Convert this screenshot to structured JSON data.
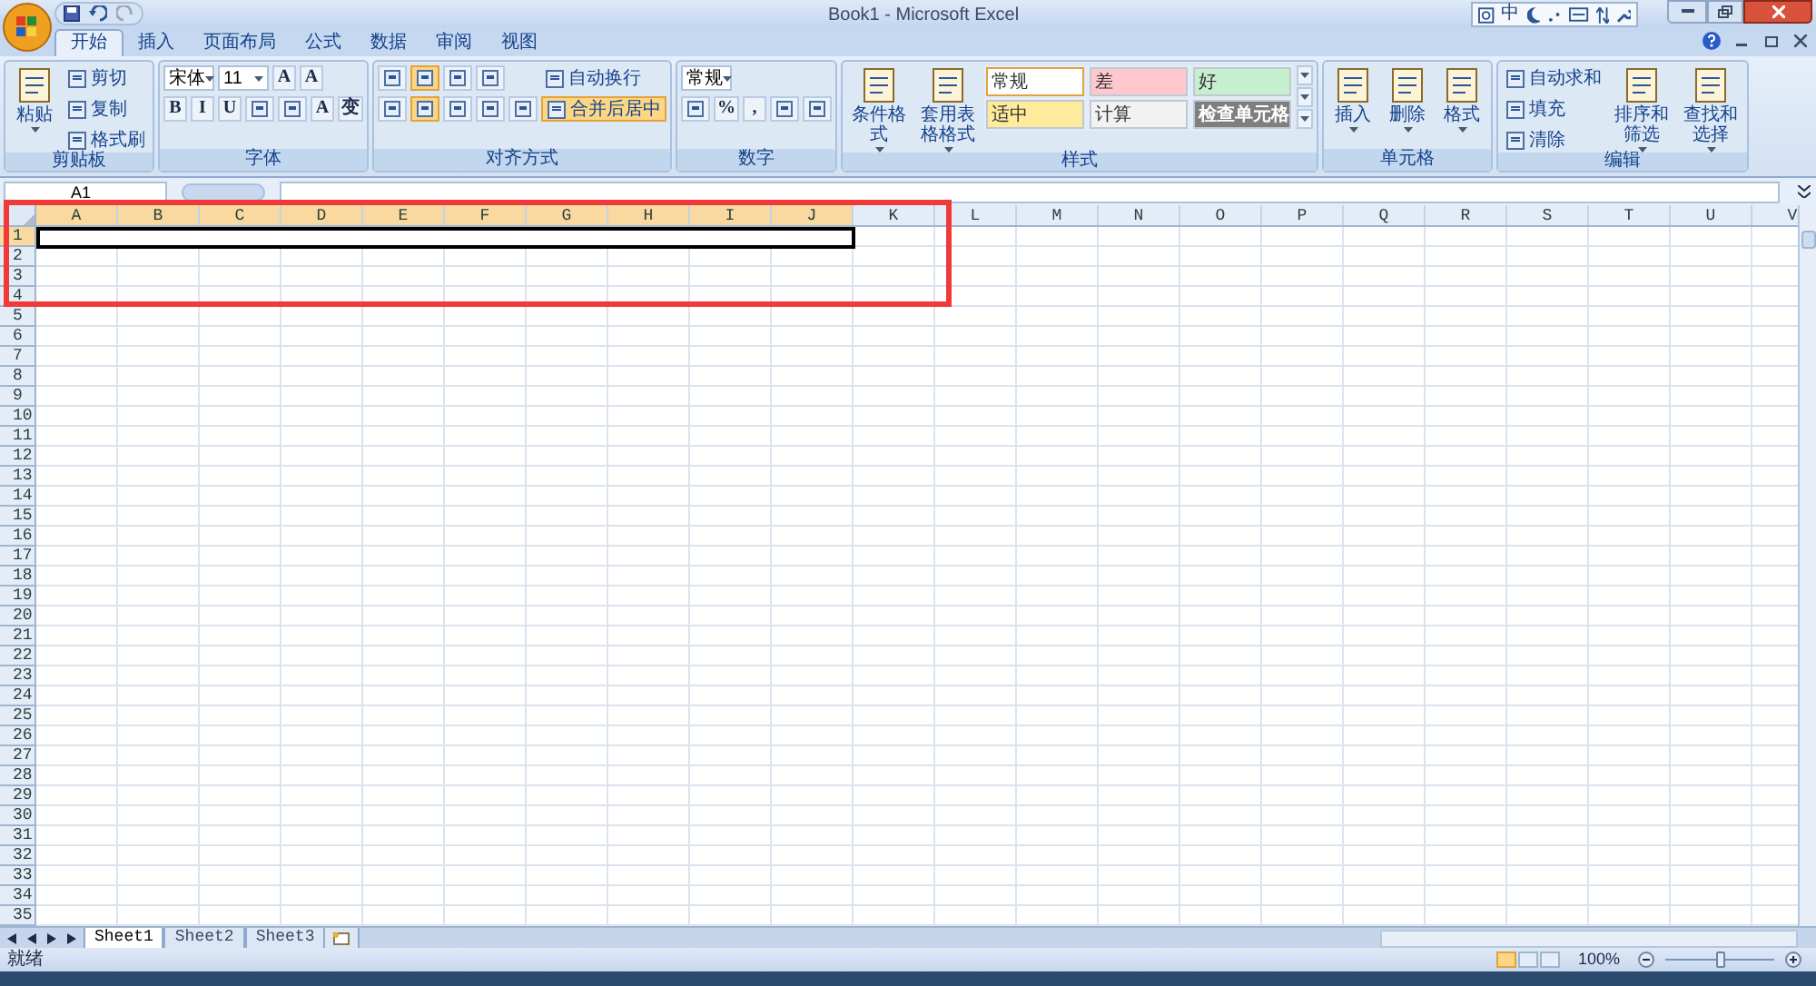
{
  "title_bar": {
    "title": "Book1 - Microsoft Excel",
    "ime_label": "中"
  },
  "tabs": [
    {
      "label": "开始",
      "selected": true
    },
    {
      "label": "插入",
      "selected": false
    },
    {
      "label": "页面布局",
      "selected": false
    },
    {
      "label": "公式",
      "selected": false
    },
    {
      "label": "数据",
      "selected": false
    },
    {
      "label": "审阅",
      "selected": false
    },
    {
      "label": "视图",
      "selected": false
    }
  ],
  "ribbon": {
    "groups": [
      {
        "label": "剪贴板",
        "items": [
          {
            "kind": "large",
            "label": "粘贴"
          },
          {
            "kind": "stack",
            "items": [
              {
                "kind": "small",
                "label": "剪切"
              },
              {
                "kind": "small",
                "label": "复制"
              },
              {
                "kind": "small",
                "label": "格式刷"
              }
            ]
          }
        ]
      },
      {
        "label": "字体",
        "items": [
          {
            "kind": "stack",
            "items": [
              {
                "kind": "row",
                "items": [
                  {
                    "kind": "combo",
                    "label": "宋体"
                  },
                  {
                    "kind": "combo",
                    "label": "11"
                  },
                  {
                    "kind": "text",
                    "label": "A"
                  },
                  {
                    "kind": "text",
                    "label": "A"
                  }
                ]
              },
              {
                "kind": "row",
                "items": [
                  {
                    "kind": "text",
                    "label": "B"
                  },
                  {
                    "kind": "text",
                    "label": "I"
                  },
                  {
                    "kind": "text",
                    "label": "U"
                  },
                  {
                    "kind": "icon"
                  },
                  {
                    "kind": "icon"
                  },
                  {
                    "kind": "text",
                    "label": "A"
                  },
                  {
                    "kind": "text",
                    "label": "变"
                  }
                ]
              }
            ]
          }
        ]
      },
      {
        "label": "对齐方式",
        "items": [
          {
            "kind": "stack",
            "items": [
              {
                "kind": "row",
                "items": [
                  {
                    "kind": "icon",
                    "on": false
                  },
                  {
                    "kind": "icon",
                    "on": true
                  },
                  {
                    "kind": "icon",
                    "on": false
                  },
                  {
                    "kind": "icon",
                    "on": false
                  }
                ]
              },
              {
                "kind": "row",
                "items": [
                  {
                    "kind": "icon",
                    "on": false
                  },
                  {
                    "kind": "icon",
                    "on": true
                  },
                  {
                    "kind": "icon",
                    "on": false
                  },
                  {
                    "kind": "icon",
                    "on": false
                  },
                  {
                    "kind": "icon",
                    "on": false
                  }
                ]
              }
            ]
          },
          {
            "kind": "stack",
            "items": [
              {
                "kind": "small",
                "label": "自动换行",
                "on": false
              },
              {
                "kind": "small",
                "label": "合并后居中",
                "on": true
              }
            ]
          }
        ]
      },
      {
        "label": "数字",
        "items": [
          {
            "kind": "stack",
            "items": [
              {
                "kind": "combo",
                "label": "常规"
              },
              {
                "kind": "row",
                "items": [
                  {
                    "kind": "icon"
                  },
                  {
                    "kind": "text",
                    "label": "%"
                  },
                  {
                    "kind": "text",
                    "label": ","
                  },
                  {
                    "kind": "icon"
                  },
                  {
                    "kind": "icon"
                  }
                ]
              }
            ]
          }
        ]
      },
      {
        "label": "样式",
        "items": [
          {
            "kind": "large",
            "label": "条件格式"
          },
          {
            "kind": "large",
            "label": "套用表格格式"
          },
          {
            "kind": "styles",
            "items": [
              {
                "label": "常规",
                "color": "#ffffff"
              },
              {
                "label": "差",
                "color": "#ffc7ce"
              },
              {
                "label": "好",
                "color": "#c6efce"
              },
              {
                "label": "适中",
                "color": "#ffeb9c"
              },
              {
                "label": "计算",
                "color": "#f2f2f2"
              },
              {
                "label": "检查单元格",
                "color": "#7f7f7f"
              }
            ]
          }
        ]
      },
      {
        "label": "单元格",
        "items": [
          {
            "kind": "large",
            "label": "插入"
          },
          {
            "kind": "large",
            "label": "删除"
          },
          {
            "kind": "large",
            "label": "格式"
          }
        ]
      },
      {
        "label": "编辑",
        "items": [
          {
            "kind": "stack",
            "items": [
              {
                "kind": "small",
                "label": "自动求和"
              },
              {
                "kind": "small",
                "label": "填充"
              },
              {
                "kind": "small",
                "label": "清除"
              }
            ]
          },
          {
            "kind": "large",
            "label": "排序和筛选"
          },
          {
            "kind": "large",
            "label": "查找和选择"
          }
        ]
      }
    ]
  },
  "formula_bar": {
    "name_box": "A1"
  },
  "sheet": {
    "columns": [
      {
        "label": "A",
        "selected": true
      },
      {
        "label": "B",
        "selected": true
      },
      {
        "label": "C",
        "selected": true
      },
      {
        "label": "D",
        "selected": true
      },
      {
        "label": "E",
        "selected": true
      },
      {
        "label": "F",
        "selected": true
      },
      {
        "label": "G",
        "selected": true
      },
      {
        "label": "H",
        "selected": true
      },
      {
        "label": "I",
        "selected": true
      },
      {
        "label": "J",
        "selected": true
      },
      {
        "label": "K",
        "selected": false
      },
      {
        "label": "L",
        "selected": false
      },
      {
        "label": "M",
        "selected": false
      },
      {
        "label": "N",
        "selected": false
      },
      {
        "label": "O",
        "selected": false
      },
      {
        "label": "P",
        "selected": false
      },
      {
        "label": "Q",
        "selected": false
      },
      {
        "label": "R",
        "selected": false
      },
      {
        "label": "S",
        "selected": false
      },
      {
        "label": "T",
        "selected": false
      },
      {
        "label": "U",
        "selected": false
      },
      {
        "label": "V",
        "selected": false
      }
    ],
    "rows": [
      {
        "label": "1",
        "selected": true
      },
      {
        "label": "2",
        "selected": false
      },
      {
        "label": "3",
        "selected": false
      },
      {
        "label": "4",
        "selected": false
      },
      {
        "label": "5",
        "selected": false
      },
      {
        "label": "6",
        "selected": false
      },
      {
        "label": "7",
        "selected": false
      },
      {
        "label": "8",
        "selected": false
      },
      {
        "label": "9",
        "selected": false
      },
      {
        "label": "10",
        "selected": false
      },
      {
        "label": "11",
        "selected": false
      },
      {
        "label": "12",
        "selected": false
      },
      {
        "label": "13",
        "selected": false
      },
      {
        "label": "14",
        "selected": false
      },
      {
        "label": "15",
        "selected": false
      },
      {
        "label": "16",
        "selected": false
      },
      {
        "label": "17",
        "selected": false
      },
      {
        "label": "18",
        "selected": false
      },
      {
        "label": "19",
        "selected": false
      },
      {
        "label": "20",
        "selected": false
      },
      {
        "label": "21",
        "selected": false
      },
      {
        "label": "22",
        "selected": false
      },
      {
        "label": "23",
        "selected": false
      },
      {
        "label": "24",
        "selected": false
      },
      {
        "label": "25",
        "selected": false
      },
      {
        "label": "26",
        "selected": false
      },
      {
        "label": "27",
        "selected": false
      },
      {
        "label": "28",
        "selected": false
      },
      {
        "label": "29",
        "selected": false
      },
      {
        "label": "30",
        "selected": false
      },
      {
        "label": "31",
        "selected": false
      },
      {
        "label": "32",
        "selected": false
      },
      {
        "label": "33",
        "selected": false
      },
      {
        "label": "34",
        "selected": false
      },
      {
        "label": "35",
        "selected": false
      }
    ]
  },
  "sheet_tabs": [
    {
      "label": "Sheet1",
      "selected": true
    },
    {
      "label": "Sheet2",
      "selected": false
    },
    {
      "label": "Sheet3",
      "selected": false
    }
  ],
  "status_bar": {
    "status": "就绪",
    "zoom": "100%",
    "level": 0.5
  }
}
